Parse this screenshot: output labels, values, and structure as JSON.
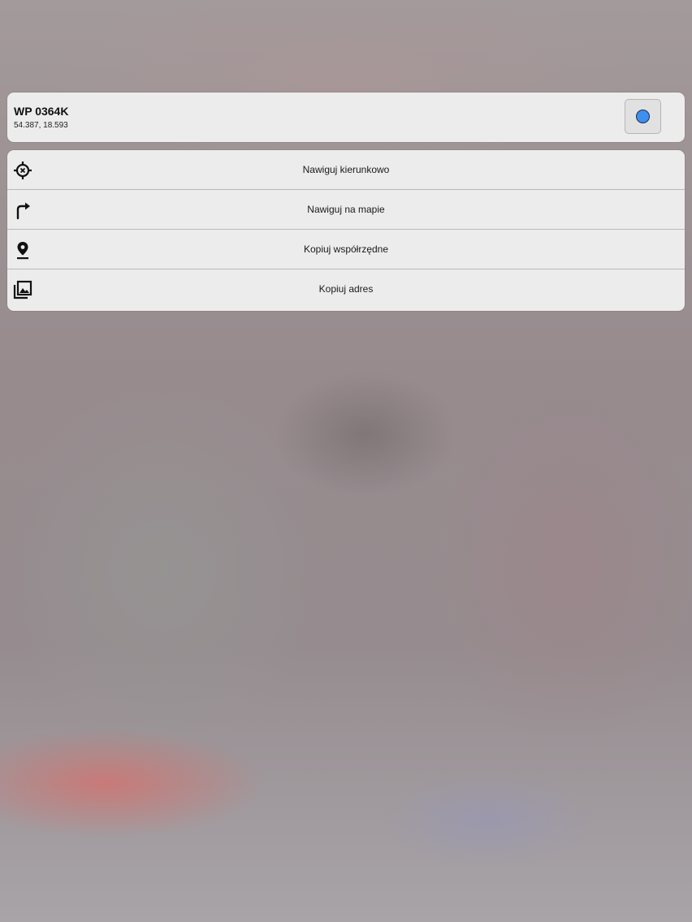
{
  "waypoint": {
    "title": "WP 0364K",
    "coordinates": "54.387, 18.593",
    "color": "#3d8ff0"
  },
  "menu": {
    "items": [
      {
        "label": "Nawiguj kierunkowo",
        "icon": "crosshair-navigation-icon"
      },
      {
        "label": "Nawiguj na mapie",
        "icon": "turn-right-arrow-icon"
      },
      {
        "label": "Kopiuj współrzędne",
        "icon": "map-pin-icon"
      },
      {
        "label": "Kopiuj adres",
        "icon": "image-stack-icon"
      }
    ]
  }
}
